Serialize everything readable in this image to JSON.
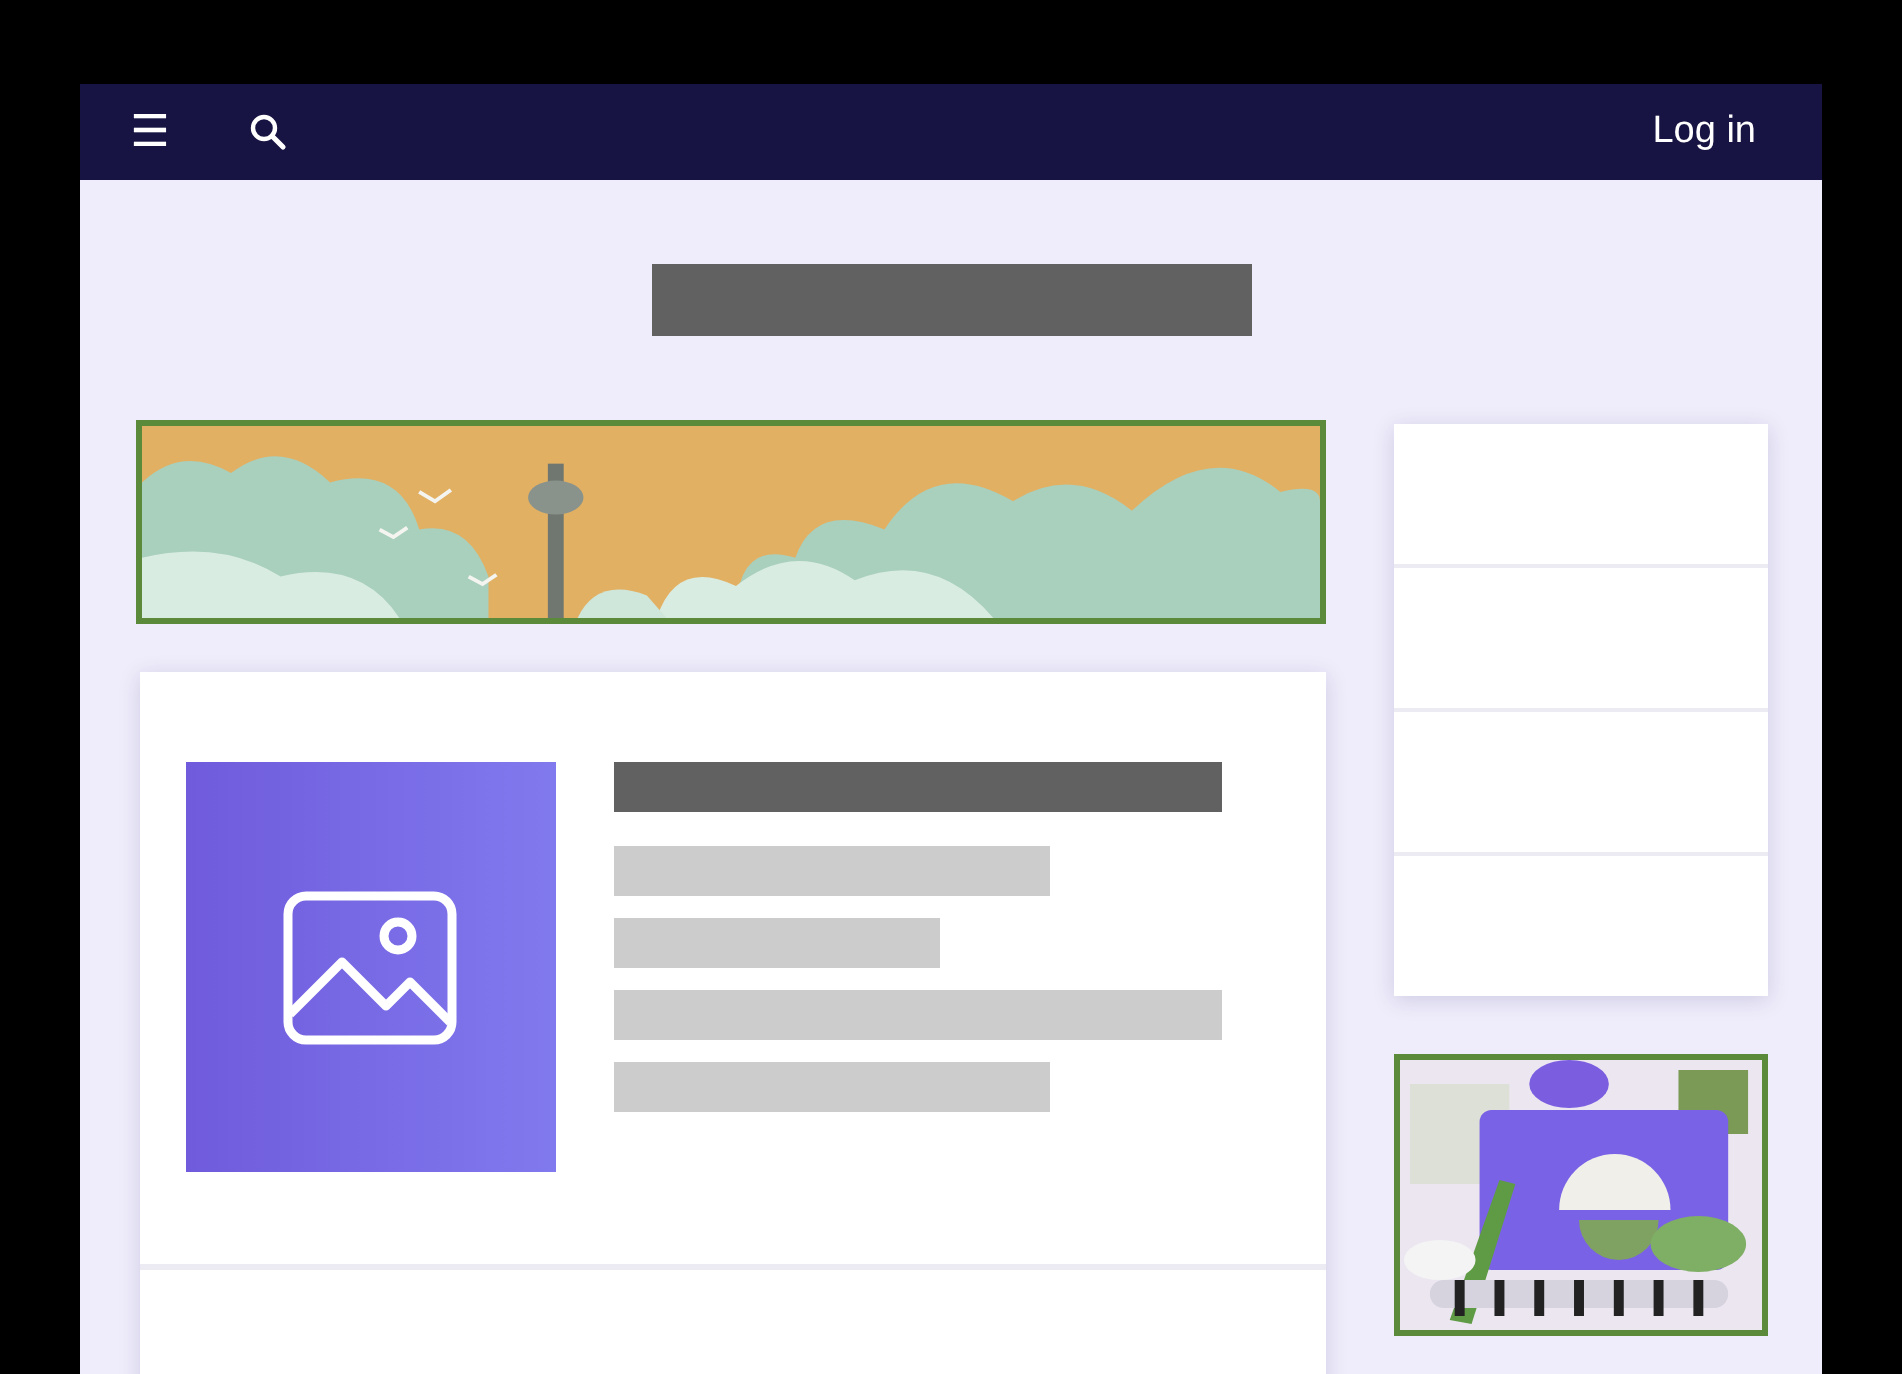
{
  "navbar": {
    "menu_button": "☰",
    "login": "Log in"
  },
  "article_card": {
    "lines": [
      {
        "kind": "heading"
      },
      {
        "kind": "medium"
      },
      {
        "kind": "short"
      },
      {
        "kind": "long"
      },
      {
        "kind": "medium"
      }
    ]
  },
  "sidebar": {
    "items": [
      {
        "kind": "empty"
      },
      {
        "kind": "empty"
      },
      {
        "kind": "empty"
      },
      {
        "kind": "empty"
      }
    ]
  }
}
